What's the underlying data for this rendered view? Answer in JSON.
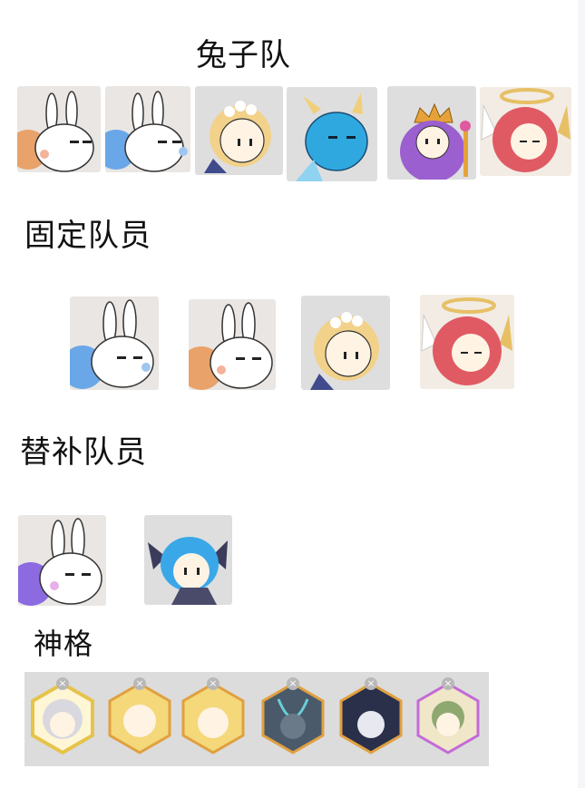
{
  "sections": {
    "team": {
      "title": "兔子队"
    },
    "fixed": {
      "title": "固定队员"
    },
    "subs": {
      "title": "替补队员"
    },
    "deity": {
      "title": "神格"
    }
  },
  "team_members": [
    {
      "icon": "bunny-orange-icon",
      "color": "#e8a26a"
    },
    {
      "icon": "bunny-blue-icon",
      "color": "#6aa7e8"
    },
    {
      "icon": "blonde-girl-icon",
      "color": "#f2d28a"
    },
    {
      "icon": "blue-dragon-icon",
      "color": "#2fa8e0"
    },
    {
      "icon": "purple-queen-icon",
      "color": "#9b5fd0"
    },
    {
      "icon": "red-angel-icon",
      "color": "#e05a64"
    }
  ],
  "fixed_members": [
    {
      "icon": "bunny-blue-icon",
      "color": "#6aa7e8"
    },
    {
      "icon": "bunny-orange-icon",
      "color": "#e8a26a"
    },
    {
      "icon": "blonde-girl-icon",
      "color": "#f2d28a"
    },
    {
      "icon": "red-angel-icon",
      "color": "#e05a64"
    }
  ],
  "sub_members": [
    {
      "icon": "bunny-purple-icon",
      "color": "#8c6ae0"
    },
    {
      "icon": "blue-hair-girl-icon",
      "color": "#3aa8e8"
    }
  ],
  "deities": [
    {
      "icon": "white-hair-deity-icon",
      "border": "#e6c34a",
      "close": "×"
    },
    {
      "icon": "blonde-horn-deity-icon",
      "border": "#e0a040",
      "close": "×"
    },
    {
      "icon": "blonde-boy-deity-icon",
      "border": "#e0a040",
      "close": "×"
    },
    {
      "icon": "dark-spirit-deity-icon",
      "border": "#e0a040",
      "close": "×"
    },
    {
      "icon": "dark-hair-deity-icon",
      "border": "#e0a040",
      "close": "×"
    },
    {
      "icon": "green-hair-deity-icon",
      "border": "#c46ad8",
      "close": "×"
    }
  ]
}
